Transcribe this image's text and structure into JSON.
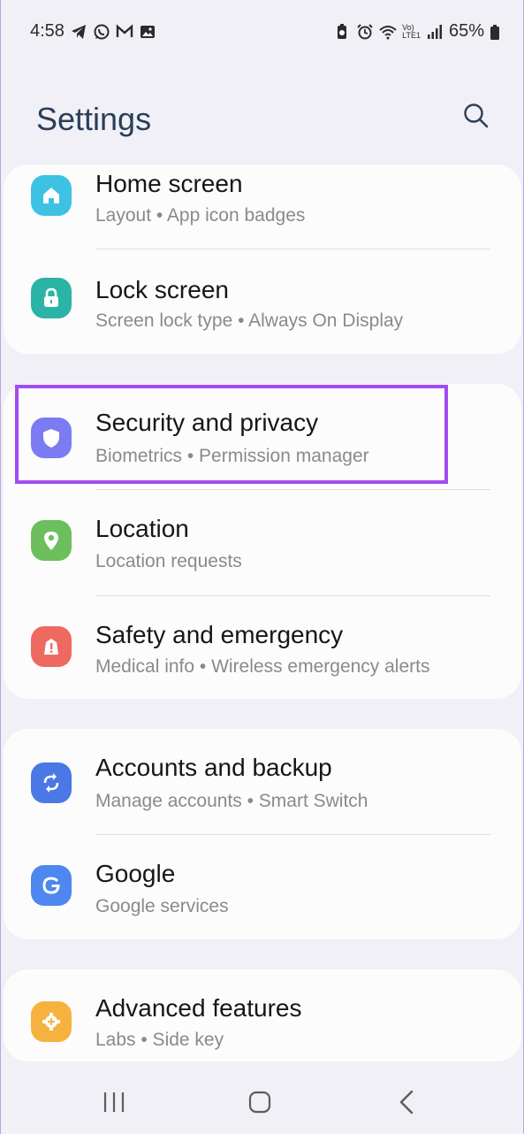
{
  "status_bar": {
    "time": "4:58",
    "battery": "65%",
    "left_icons": [
      "telegram-icon",
      "whatsapp-icon",
      "gmail-icon",
      "gallery-icon"
    ],
    "right_icons": [
      "battery-saver-icon",
      "alarm-icon",
      "wifi-icon",
      "volte-icon",
      "signal-icon",
      "battery-icon"
    ],
    "volte_label": "Vo)",
    "lte_label": "LTE1"
  },
  "header": {
    "title": "Settings"
  },
  "groups": [
    {
      "items": [
        {
          "title": "Home screen",
          "subtitle": "Layout  •  App icon badges",
          "icon": "home-icon",
          "color": "#3ec2e3"
        },
        {
          "title": "Lock screen",
          "subtitle": "Screen lock type  •  Always On Display",
          "icon": "lock-icon",
          "color": "#2bb3a6"
        }
      ]
    },
    {
      "items": [
        {
          "title": "Security and privacy",
          "subtitle": "Biometrics  •  Permission manager",
          "icon": "shield-icon",
          "color": "#7b7cf2"
        },
        {
          "title": "Location",
          "subtitle": "Location requests",
          "icon": "location-pin-icon",
          "color": "#6cbf5c"
        },
        {
          "title": "Safety and emergency",
          "subtitle": "Medical info  •  Wireless emergency alerts",
          "icon": "alert-icon",
          "color": "#ee6a61"
        }
      ]
    },
    {
      "items": [
        {
          "title": "Accounts and backup",
          "subtitle": "Manage accounts  •  Smart Switch",
          "icon": "sync-icon",
          "color": "#4a78e6"
        },
        {
          "title": "Google",
          "subtitle": "Google services",
          "icon": "google-icon",
          "color": "#4d87ef"
        }
      ]
    },
    {
      "items": [
        {
          "title": "Advanced features",
          "subtitle": "Labs  •  Side key",
          "icon": "puzzle-gear-icon",
          "color": "#f6b23e"
        }
      ]
    }
  ],
  "highlight_color": "#a24cf0",
  "nav_bar": [
    "recent-apps-icon",
    "home-nav-icon",
    "back-icon"
  ]
}
